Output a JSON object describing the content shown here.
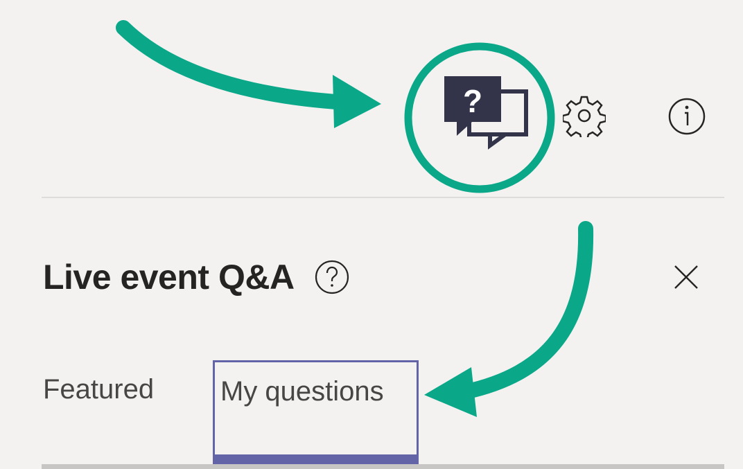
{
  "header": {
    "icons": [
      "qa-icon",
      "gear-icon",
      "info-icon"
    ]
  },
  "panel": {
    "title": "Live event Q&A",
    "help_icon": "help-icon",
    "close_icon": "close-icon"
  },
  "tabs": [
    {
      "label": "Featured",
      "selected": false
    },
    {
      "label": "My questions",
      "selected": true
    }
  ],
  "colors": {
    "accent": "#6264a7",
    "qa_icon": "#33344a",
    "annotation": "#0aa889",
    "background": "#f3f2f1"
  }
}
